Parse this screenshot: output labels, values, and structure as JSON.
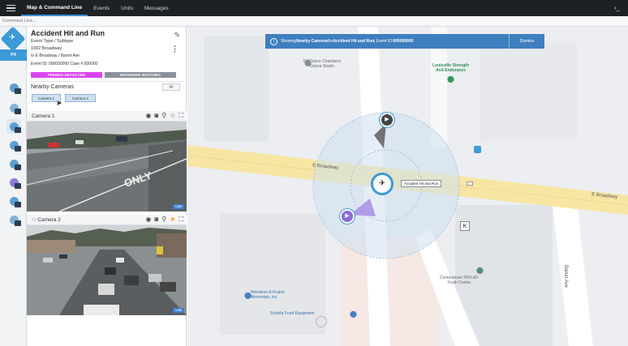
{
  "nav": {
    "tabs": [
      "Map & Command Line",
      "Events",
      "Units",
      "Messages"
    ],
    "command_placeholder": "Command Line..."
  },
  "rail": {
    "priority": "P4"
  },
  "event": {
    "title": "Accident Hit and Run",
    "type": "Event Type / Subtype",
    "address": "1002 Broadway",
    "cross": "E Broadway  /  Barret Ave",
    "ids": "Event ID: 000000000   Case #:000000",
    "tag_trends": "TRENDS DETECTED",
    "tag_informer": "INFORMER MATCHES"
  },
  "nearby": {
    "title": "Nearby Cameras",
    "chips": [
      "Camera 1",
      "Camera 2"
    ],
    "expand": "≫"
  },
  "cameras": [
    {
      "label": "Camera 1",
      "live": "LIVE",
      "star": "#555555",
      "road_text": "ONLY"
    },
    {
      "label": "Camera 2",
      "live": "LIVE",
      "star": "#f59e0b"
    }
  ],
  "banner": {
    "prefix": "Showing ",
    "bold1": "Nearby Cameras",
    "mid": " for ",
    "bold2": "Accident Hit and Run",
    "suffix": " | Event ID: ",
    "event_id": "000000000",
    "dismiss": "Dismiss"
  },
  "map": {
    "street_main": "E Broadway",
    "street_main_2": "E Broadway",
    "street_side": "Barret Ave",
    "event_label": "Accident Hit and Run",
    "pois": {
      "dance": "F3 Dance Chambers\nDance Studio",
      "louisville": "Louisville Strength\nAnd Endurance",
      "centerstone": "Centerstone-TAYLAD\nYouth Center",
      "woodson": "Woodson & Kratch\nMemorials, Inc.",
      "scholla": "Scholla Food Equipment"
    }
  },
  "colors": {
    "accent": "#3c9ad6",
    "trends": "#d946ef",
    "road": "#f7e6a3",
    "banner": "#3e7fbf"
  }
}
